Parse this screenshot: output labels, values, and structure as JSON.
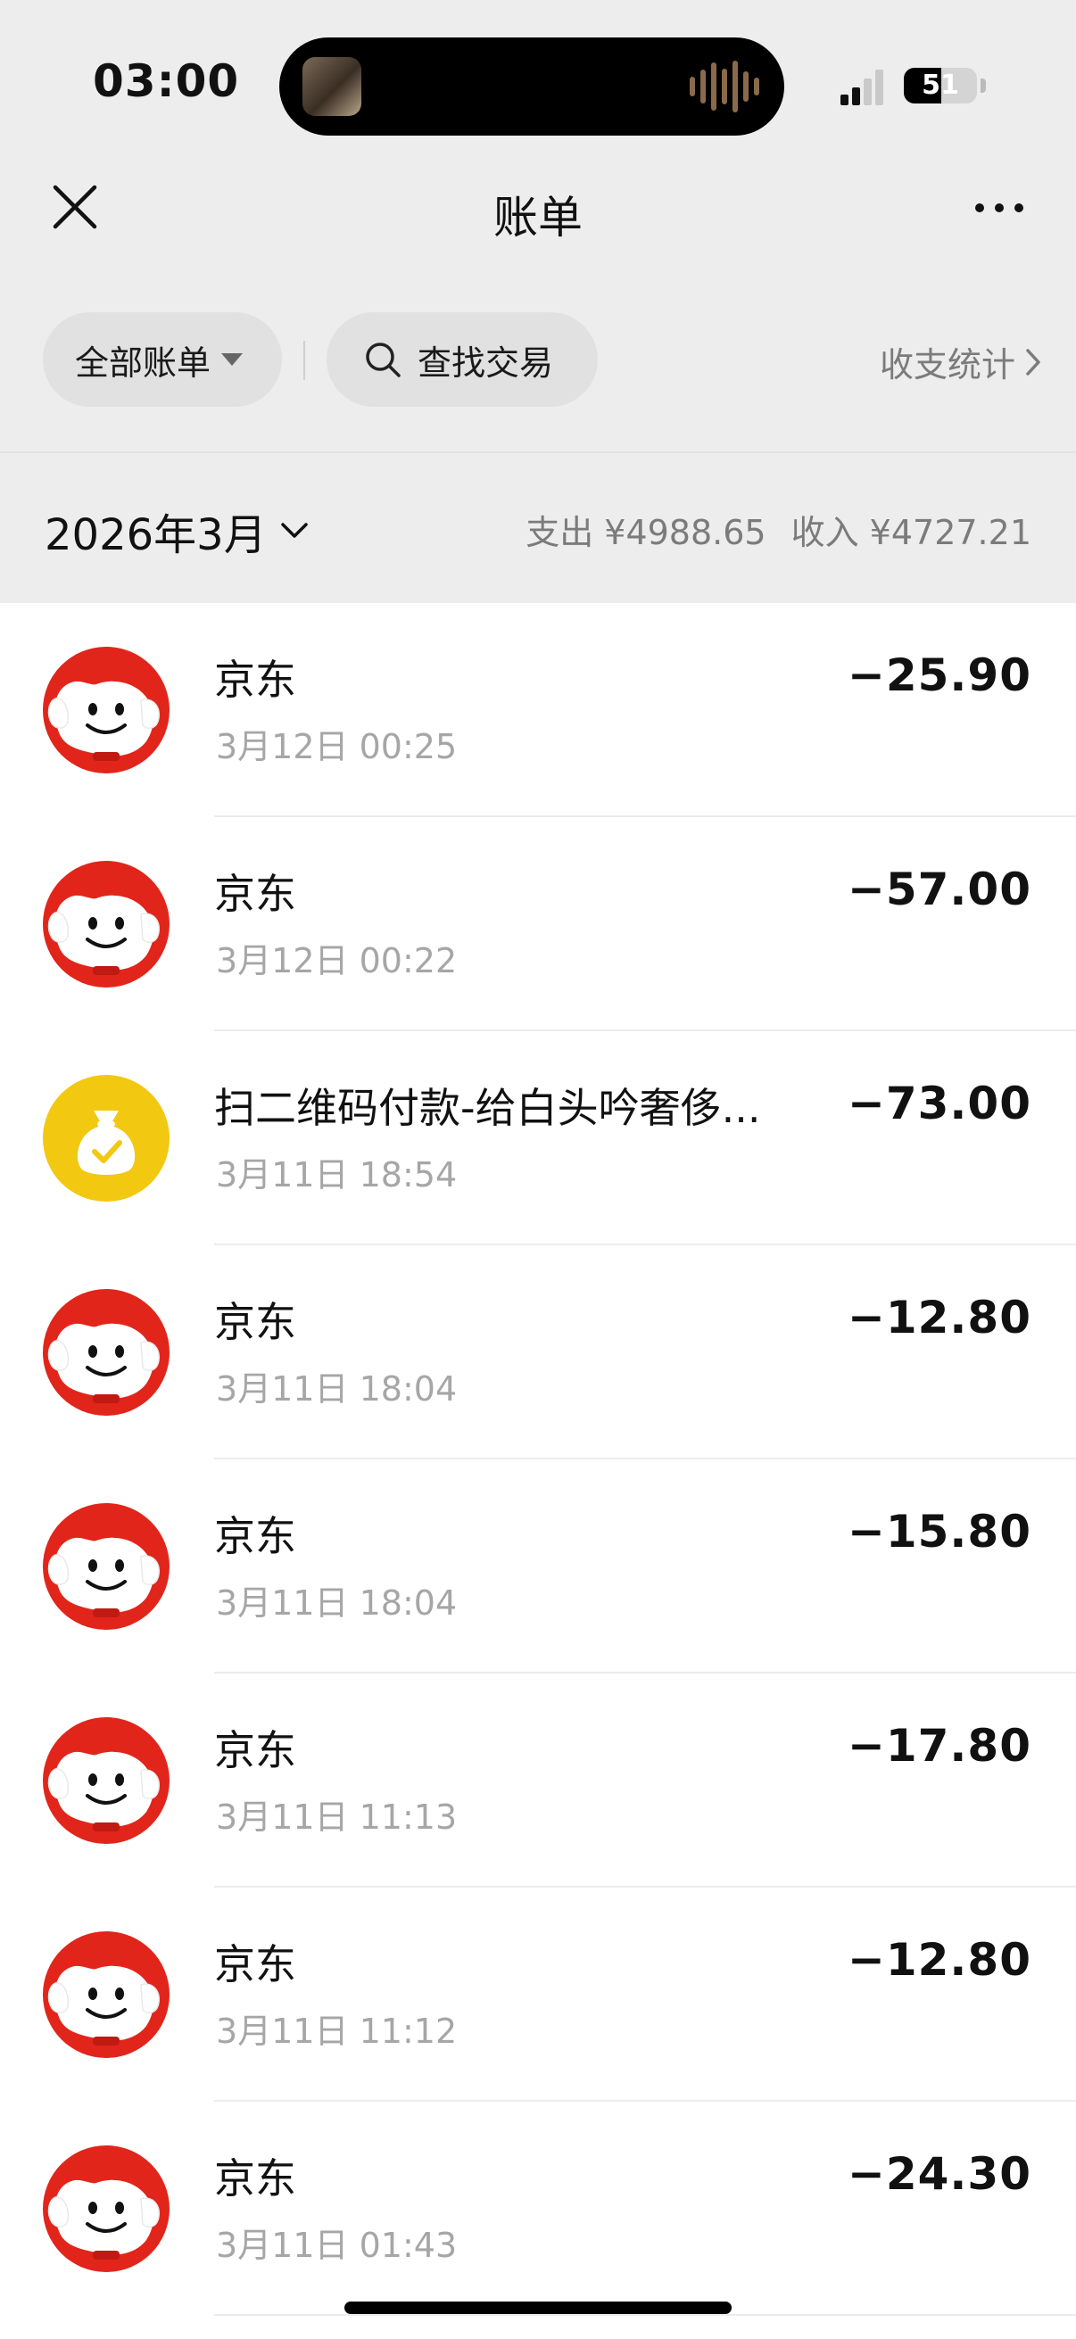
{
  "status_bar": {
    "time": "03:00",
    "battery": "51",
    "battery_level_percent": 51
  },
  "nav": {
    "title": "账单"
  },
  "filters": {
    "all_bills_label": "全部账单",
    "search_label": "查找交易",
    "stats_label": "收支统计"
  },
  "summary": {
    "month": "2026年3月",
    "expense": "支出 ¥4988.65",
    "income": "收入 ¥4727.21"
  },
  "transactions": [
    {
      "name": "京东",
      "time": "3月12日 00:25",
      "amount": "−25.90",
      "icon": "jd-dog-icon"
    },
    {
      "name": "京东",
      "time": "3月12日 00:22",
      "amount": "−57.00",
      "icon": "jd-dog-icon"
    },
    {
      "name": "扫二维码付款-给白头吟奢侈...",
      "time": "3月11日 18:54",
      "amount": "−73.00",
      "icon": "money-bag-icon"
    },
    {
      "name": "京东",
      "time": "3月11日 18:04",
      "amount": "−12.80",
      "icon": "jd-dog-icon"
    },
    {
      "name": "京东",
      "time": "3月11日 18:04",
      "amount": "−15.80",
      "icon": "jd-dog-icon"
    },
    {
      "name": "京东",
      "time": "3月11日 11:13",
      "amount": "−17.80",
      "icon": "jd-dog-icon"
    },
    {
      "name": "京东",
      "time": "3月11日 11:12",
      "amount": "−12.80",
      "icon": "jd-dog-icon"
    },
    {
      "name": "京东",
      "time": "3月11日 01:43",
      "amount": "−24.30",
      "icon": "jd-dog-icon"
    }
  ],
  "colors": {
    "header_bg": "#ededed",
    "pill_bg": "#e1e1e1",
    "jd_red": "#e1251b",
    "wechat_yellow": "#f2c811",
    "secondary_text": "#a6a6a6"
  }
}
